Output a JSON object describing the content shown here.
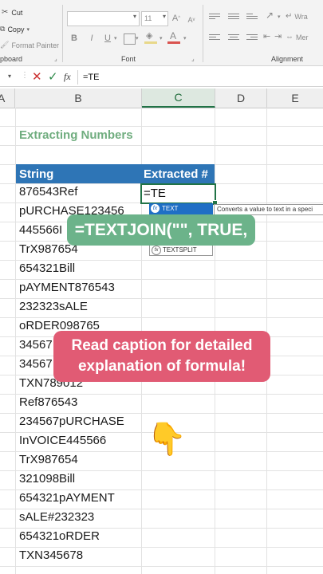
{
  "ribbon": {
    "clipboard": {
      "cut_label": "Cut",
      "copy_label": "Copy",
      "format_painter_label": "Format Painter",
      "group_label": "pboard"
    },
    "font": {
      "size_value": "11",
      "group_label": "Font",
      "bold": "B",
      "italic": "I",
      "underline": "U",
      "font_color_letter": "A",
      "highlight_letter": "A"
    },
    "alignment": {
      "wrap_label": "Wra",
      "merge_label": "Mer",
      "group_label": "Alignment"
    }
  },
  "formula_bar": {
    "fx_label": "fx",
    "formula": "=TE"
  },
  "columns": [
    "A",
    "B",
    "C",
    "D",
    "E"
  ],
  "sheet": {
    "heading": "Extracting Numbers",
    "header_string": "String",
    "header_extracted": "Extracted #",
    "active_cell_value": "=TE",
    "rows": [
      "876543Ref",
      "pURCHASE123456",
      "445566I",
      "TrX987654",
      "654321Bill",
      "pAYMENT876543",
      "232323sALE",
      "oRDER098765",
      "34567",
      "34567",
      "TXN789012",
      "Ref876543",
      "234567pURCHASE",
      "InVOICE445566",
      "TrX987654",
      "321098Bill",
      "654321pAYMENT",
      "sALE#232323",
      "654321oRDER",
      "TXN345678"
    ]
  },
  "autocomplete": {
    "items": [
      "TEXT",
      "TEXTSPLIT"
    ],
    "tooltip": "Converts a value to text in a speci"
  },
  "overlays": {
    "formula_caption": "=TEXTJOIN(\"\", TRUE,",
    "read_caption_line1": "Read caption for detailed",
    "read_caption_line2": "explanation of formula!",
    "emoji": "👇"
  },
  "colors": {
    "accent_green": "#217346",
    "table_header_blue": "#2e75b6",
    "heading_green": "#70ad7f",
    "overlay_green": "#6cb38a",
    "overlay_red": "#e15b74"
  }
}
